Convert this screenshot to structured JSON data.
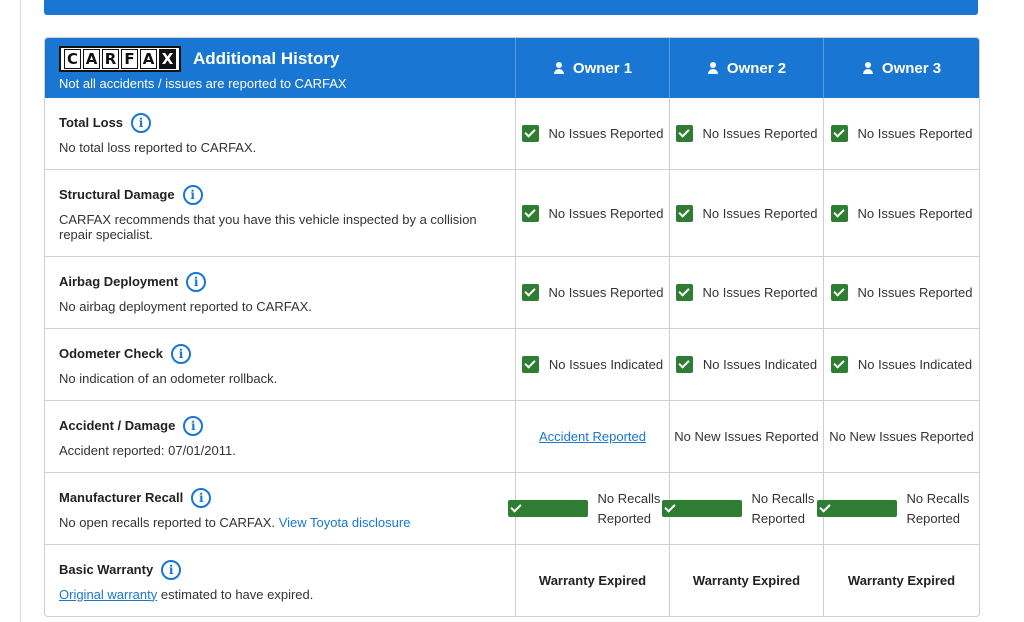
{
  "header": {
    "logo_letters": [
      "C",
      "A",
      "R",
      "F",
      "A",
      "X"
    ],
    "title": "Additional History",
    "subtitle": "Not all accidents / issues are reported to CARFAX",
    "owners": [
      "Owner 1",
      "Owner 2",
      "Owner 3"
    ]
  },
  "rows": [
    {
      "title": "Total Loss",
      "desc": "No total loss reported to CARFAX.",
      "status": [
        "No Issues Reported",
        "No Issues Reported",
        "No Issues Reported"
      ]
    },
    {
      "title": "Structural Damage",
      "desc": "CARFAX recommends that you have this vehicle inspected by a collision repair specialist.",
      "status": [
        "No Issues Reported",
        "No Issues Reported",
        "No Issues Reported"
      ]
    },
    {
      "title": "Airbag Deployment",
      "desc": "No airbag deployment reported to CARFAX.",
      "status": [
        "No Issues Reported",
        "No Issues Reported",
        "No Issues Reported"
      ]
    },
    {
      "title": "Odometer Check",
      "desc": "No indication of an odometer rollback.",
      "status": [
        "No Issues Indicated",
        "No Issues Indicated",
        "No Issues Indicated"
      ]
    },
    {
      "title": "Accident / Damage",
      "desc": "Accident reported: 07/01/2011.",
      "status": [
        "Accident Reported",
        "No New Issues Reported",
        "No New Issues Reported"
      ]
    },
    {
      "title": "Manufacturer Recall",
      "desc": "No open recalls reported to CARFAX.",
      "link": "View Toyota disclosure",
      "status": [
        "No Recalls Reported",
        "No Recalls Reported",
        "No Recalls Reported"
      ]
    },
    {
      "title": "Basic Warranty",
      "link": "Original warranty",
      "desc": "estimated to have expired.",
      "status": [
        "Warranty Expired",
        "Warranty Expired",
        "Warranty Expired"
      ]
    }
  ],
  "colors": {
    "accent": "#1976d2",
    "check": "#2e7d32"
  }
}
